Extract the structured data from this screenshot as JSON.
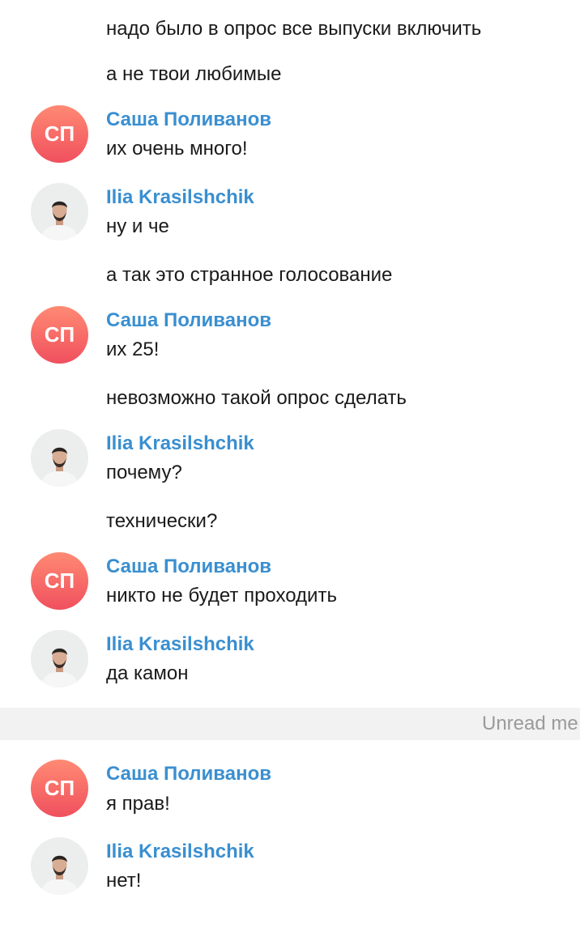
{
  "messages": [
    {
      "text": "надо было в опрос все выпуски включить"
    },
    {
      "text": "а не твои любимые"
    },
    {
      "author": "Саша Поливанов",
      "initials": "СП",
      "text": "их очень много!"
    },
    {
      "author": "Ilia Krasilshchik",
      "text": "ну и че"
    },
    {
      "text": "а так это странное голосование"
    },
    {
      "author": "Саша Поливанов",
      "initials": "СП",
      "text": "их 25!"
    },
    {
      "text": "невозможно такой опрос сделать"
    },
    {
      "author": "Ilia Krasilshchik",
      "text": "почему?"
    },
    {
      "text": "технически?"
    },
    {
      "author": "Саша Поливанов",
      "initials": "СП",
      "text": "никто не будет проходить"
    },
    {
      "author": "Ilia Krasilshchik",
      "text": "да камон"
    },
    {
      "author": "Саша Поливанов",
      "initials": "СП",
      "text": "я прав!"
    },
    {
      "author": "Ilia Krasilshchik",
      "text": "нет!"
    }
  ],
  "unread_divider": "Unread me",
  "colors": {
    "author_name": "#3a8fd0",
    "avatar_sp_top": "#ff8a73",
    "avatar_sp_bottom": "#f0505e",
    "divider_bg": "#f2f2f2",
    "divider_text": "#9a9a9a"
  },
  "icons": {
    "ilia_avatar": "person-photo-avatar"
  }
}
